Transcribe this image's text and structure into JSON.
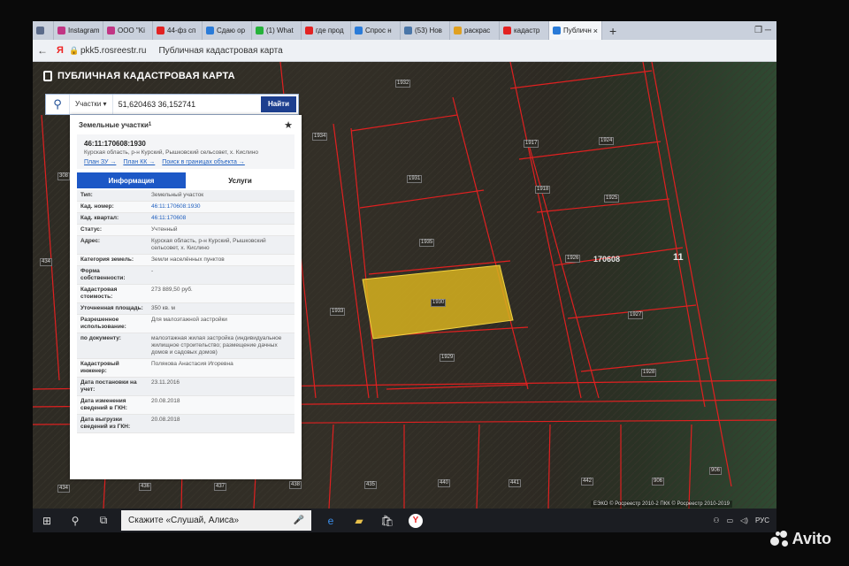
{
  "browser": {
    "tabs": [
      {
        "label": "",
        "icon": "browser-menu-icon",
        "color": "#5b6b8a"
      },
      {
        "label": "Instagram",
        "icon": "instagram-icon",
        "color": "#c13584"
      },
      {
        "label": "ООО \"Ki",
        "icon": "instagram-icon",
        "color": "#c13584"
      },
      {
        "label": "44-фз сп",
        "icon": "yandex-icon",
        "color": "#e22222"
      },
      {
        "label": "Сдаю ор",
        "icon": "avito-icon",
        "color": "#2a7bd8"
      },
      {
        "label": "(1) What",
        "icon": "whatsapp-icon",
        "color": "#25b23a"
      },
      {
        "label": "где прод",
        "icon": "yandex-icon",
        "color": "#e22222"
      },
      {
        "label": "Спрос н",
        "icon": "avito-icon",
        "color": "#2a7bd8"
      },
      {
        "label": "(53) Нов",
        "icon": "vk-icon",
        "color": "#4a76a8"
      },
      {
        "label": "раскрас",
        "icon": "image-icon",
        "color": "#e0a020"
      },
      {
        "label": "кадастр",
        "icon": "yandex-icon",
        "color": "#e22222"
      },
      {
        "label": "Публичн",
        "icon": "rosreestr-icon",
        "color": "#2a7bd8"
      }
    ],
    "url": "pkk5.rosreestr.ru",
    "page_title": "Публичная кадастровая карта",
    "close_glyph": "×",
    "new_tab_glyph": "+"
  },
  "header": {
    "title": "ПУБЛИЧНАЯ КАДАСТРОВАЯ КАРТА"
  },
  "search": {
    "type_label": "Участки ▾",
    "value": "51,620463 36,152741",
    "button": "Найти"
  },
  "panel": {
    "heading": "Земельные участки",
    "heading_sup": "1",
    "cadastral_number": "46:11:170608:1930",
    "address_short": "Курская область, р-н Курский, Рышковский сельсовет, х. Кислино",
    "links": [
      "План ЗУ →",
      "План КК →",
      "Поиск в границах объекта →"
    ],
    "tab_info": "Информация",
    "tab_services": "Услуги",
    "rows": [
      {
        "k": "Тип:",
        "v": "Земельный участок",
        "link": false
      },
      {
        "k": "Кад. номер:",
        "v": "46:11:170608:1930",
        "link": true
      },
      {
        "k": "Кад. квартал:",
        "v": "46:11:170608",
        "link": true
      },
      {
        "k": "Статус:",
        "v": "Учтенный",
        "link": false
      },
      {
        "k": "Адрес:",
        "v": "Курская область, р-н Курский, Рышковский сельсовет, х. Кислино",
        "link": false
      },
      {
        "k": "Категория земель:",
        "v": "Земли населённых пунктов",
        "link": false
      },
      {
        "k": "Форма собственности:",
        "v": "-",
        "link": false
      },
      {
        "k": "Кадастровая стоимость:",
        "v": "273 889,50 руб.",
        "link": false
      },
      {
        "k": "Уточненная площадь:",
        "v": "350 кв. м",
        "link": false
      },
      {
        "k": "Разрешенное использование:",
        "v": "Для малоэтажной застройки",
        "link": false
      },
      {
        "k": "по документу:",
        "v": "малоэтажная жилая застройка (индивидуальное жилищное строительство; размещение дачных домов и садовых домов)",
        "link": false
      },
      {
        "k": "Кадастровый инженер:",
        "v": "Полякова Анастасия Игоревна",
        "link": false
      },
      {
        "k": "Дата постановки на учет:",
        "v": "23.11.2016",
        "link": false
      },
      {
        "k": "Дата изменения сведений в ГКН:",
        "v": "20.08.2018",
        "link": false
      },
      {
        "k": "Дата выгрузки сведений из ГКН:",
        "v": "20.08.2018",
        "link": false
      }
    ]
  },
  "map": {
    "parcel_labels": [
      "1930",
      "1931",
      "1932",
      "1934",
      "1924",
      "1925",
      "1926",
      "1927",
      "1928",
      "1929",
      "1933",
      "1935",
      "438",
      "437",
      "436",
      "435",
      "434",
      "440",
      "441",
      "442",
      "906",
      "308",
      "1917",
      "1918"
    ],
    "block_label": "170608",
    "big_label": "11",
    "copyright": "ЕЭКО © Росреестр 2010-2 ПКК © Росреестр 2010-2019",
    "highlight_color": "#d7b21e",
    "border_color": "#e02020"
  },
  "taskbar": {
    "search_placeholder": "Скажите «Слушай, Алиса»",
    "lang": "РУС"
  },
  "watermark": {
    "text": "Avito"
  }
}
